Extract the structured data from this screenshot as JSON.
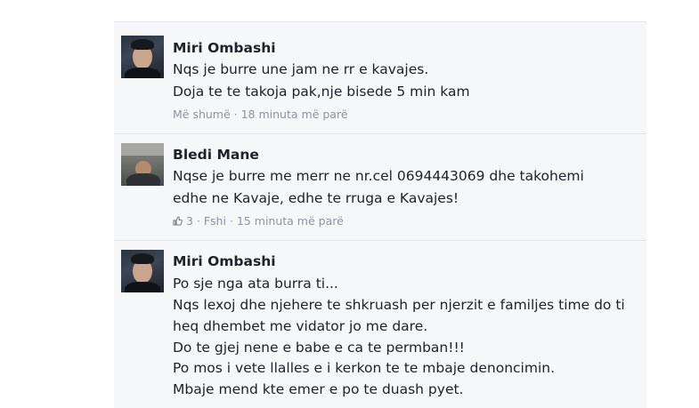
{
  "comments": [
    {
      "author": "Miri Ombashi",
      "lines": [
        "Nqs je burre une jam ne rr e kavajes.",
        "Doja te te takoja pak,nje bisede 5 min kam"
      ],
      "meta": {
        "more": "Më shumë",
        "separator": " · ",
        "time": "18 minuta më parë"
      }
    },
    {
      "author": "Bledi Mane",
      "lines": [
        "Nqse je burre me merr ne nr.cel 0694443069 dhe takohemi",
        "edhe ne Kavaje, edhe te rruga e Kavajes!"
      ],
      "meta": {
        "likes": "3",
        "separator": " · ",
        "delete": "Fshi",
        "time": "15 minuta më parë"
      }
    },
    {
      "author": "Miri Ombashi",
      "lines": [
        "Po sje nga ata burra ti...",
        "Nqs lexoj dhe njehere te shkruash per njerzit e familjes time do ti",
        "heq dhembet me vidator jo me dare.",
        "Do te gjej nene e babe e ca te permban!!!",
        "Po mos i vete llalles e i kerkon te te mbaje denoncimin.",
        "Mbaje mend kte emer e po te duash pyet."
      ]
    }
  ],
  "colors": {
    "panel_bg": "#f6f7f9",
    "name": "#1f2329",
    "meta": "#8d949e"
  }
}
